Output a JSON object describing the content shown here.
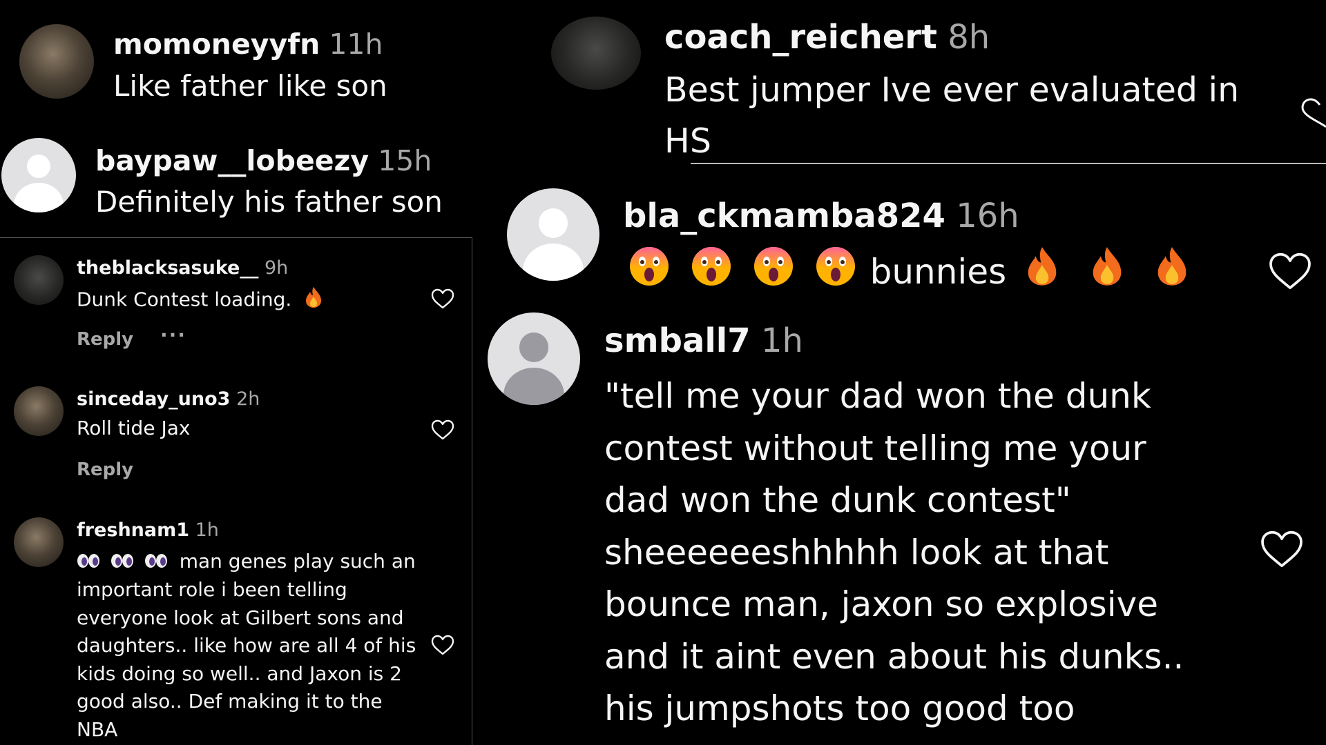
{
  "comments": {
    "momoney": {
      "username": "momoneyyfn",
      "time": "11h",
      "text": "Like father like son"
    },
    "baypaw": {
      "username": "baypaw__lobeezy",
      "time": "15h",
      "text": "Definitely his father son"
    },
    "sasuke": {
      "username": "theblacksasuke__",
      "time": "9h",
      "text": "Dunk Contest loading.",
      "reply": "Reply",
      "more": "···"
    },
    "sinceday": {
      "username": "sinceday_uno3",
      "time": "2h",
      "text": "Roll tide Jax",
      "reply": "Reply"
    },
    "freshnam": {
      "username": "freshnam1",
      "time": "1h",
      "lines": [
        "man genes play such an",
        "important role i been telling",
        "everyone look at Gilbert sons and",
        "daughters.. like how are all 4 of his",
        "kids doing so well.. and Jaxon is 2",
        "good also.. Def making it to the",
        "NBA"
      ]
    },
    "coach": {
      "username": "coach_reichert",
      "time": "8h",
      "lines": [
        "Best jumper Ive ever evaluated in",
        "HS"
      ]
    },
    "mamba": {
      "username": "bla_ckmamba824",
      "time": "16h",
      "text": "bunnies"
    },
    "smball": {
      "username": "smball7",
      "time": "1h",
      "lines": [
        "\"tell me your dad won the dunk",
        "contest without telling me your",
        "dad won the dunk contest\"",
        "sheeeeeeshhhhh look at that",
        "bounce man, jaxon so explosive",
        "and it aint even about his dunks..",
        "his jumpshots too good too"
      ]
    }
  },
  "icons": {
    "like": "heart-outline-icon",
    "fire": "fire-emoji-icon",
    "shocked": "shocked-face-emoji-icon",
    "eyes": "eyes-emoji-icon"
  },
  "colors": {
    "background": "#000000",
    "text": "#f5f5f5",
    "secondary": "#a8a8a8",
    "avatar_default": "#e1e1e3"
  }
}
